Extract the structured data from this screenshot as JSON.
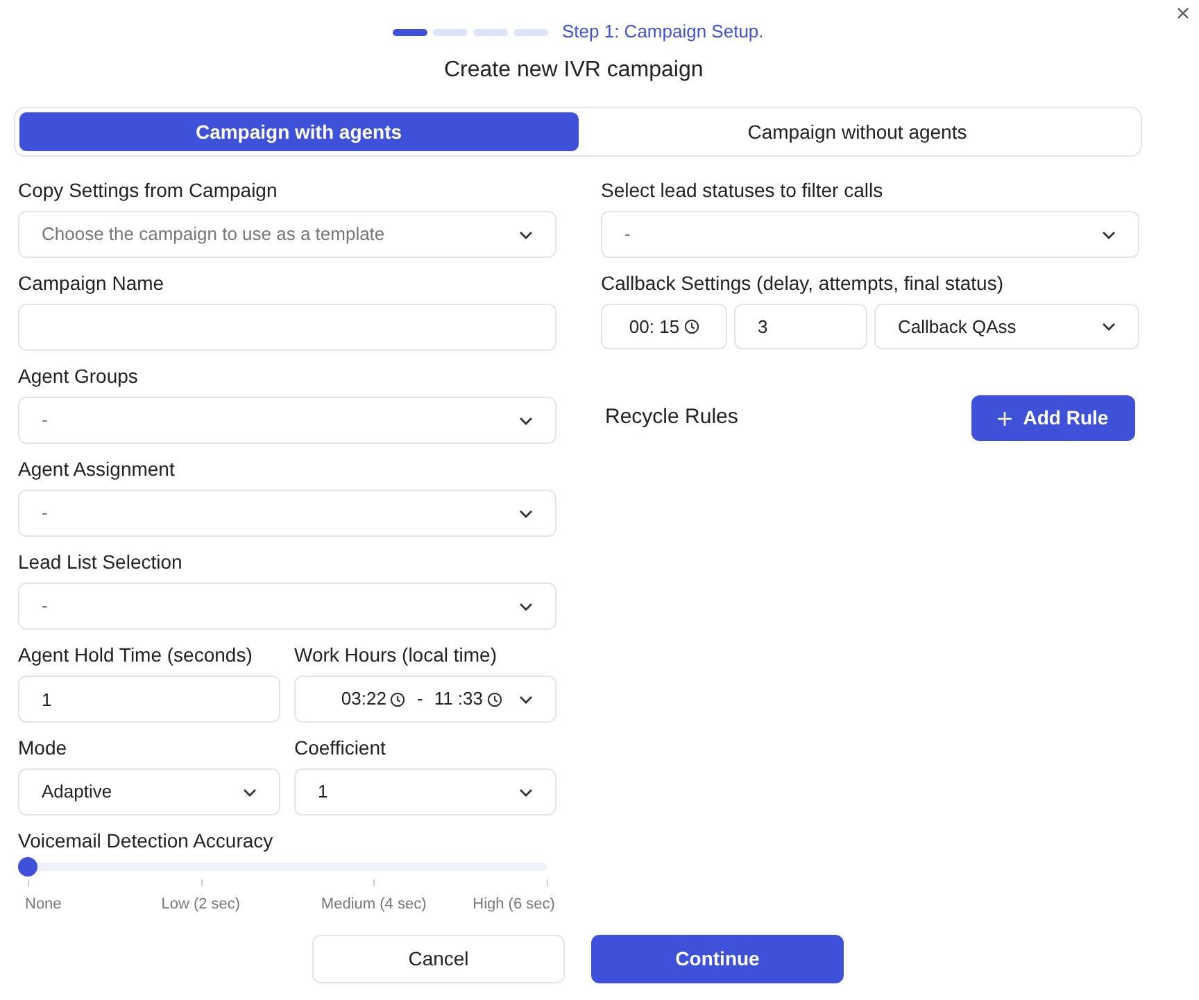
{
  "steps": [
    {
      "selected": true
    },
    {
      "selected": false
    },
    {
      "selected": false
    },
    {
      "selected": false
    }
  ],
  "step_label": "Step 1: Campaign Setup.",
  "title": "Create new IVR campaign",
  "tabs": [
    {
      "label": "Campaign with agents",
      "selected": true
    },
    {
      "label": "Campaign without agents",
      "selected": false
    }
  ],
  "left_fields": [
    {
      "kind": "select",
      "label": "Copy Settings from Campaign",
      "placeholder": "Choose the campaign to use as a template"
    },
    {
      "kind": "input",
      "label": "Campaign Name"
    },
    {
      "kind": "select",
      "label": "Agent Groups",
      "placeholder": "-"
    },
    {
      "kind": "select",
      "label": "Agent Assignment",
      "placeholder": "-"
    },
    {
      "kind": "select",
      "label": "Lead List Selection",
      "placeholder": "-"
    },
    {
      "kind": "pair",
      "items": [
        {
          "kind": "input",
          "label": "Agent Hold Time (seconds)",
          "value": "1"
        },
        {
          "kind": "time_range",
          "label": "Work Hours (local time)",
          "start": "03:22",
          "separator": "-",
          "end": "11 :33"
        }
      ]
    },
    {
      "kind": "pair",
      "items": [
        {
          "kind": "select",
          "label": "Mode",
          "value": "Adaptive"
        },
        {
          "kind": "select",
          "label": "Coefficient",
          "value": "1"
        }
      ]
    }
  ],
  "slider": {
    "label": "Voicemail Detection Accuracy",
    "level": 0,
    "ticks": [
      "None",
      "Low (2 sec)",
      "Medium (4 sec)",
      "High (6 sec)"
    ]
  },
  "right_fields": [
    {
      "kind": "select",
      "label": "Select lead statuses to filter calls",
      "placeholder": "-"
    },
    {
      "kind": "callback",
      "label": "Callback Settings (delay, attempts, final status)",
      "delay": "00: 15",
      "attempts": "3",
      "final_status": "Callback QAss"
    }
  ],
  "recycle": {
    "label": "Recycle Rules",
    "button": "Add Rule"
  },
  "buttons": [
    {
      "kind": "secondary",
      "label": "Cancel"
    },
    {
      "kind": "primary",
      "label": "Continue"
    }
  ]
}
